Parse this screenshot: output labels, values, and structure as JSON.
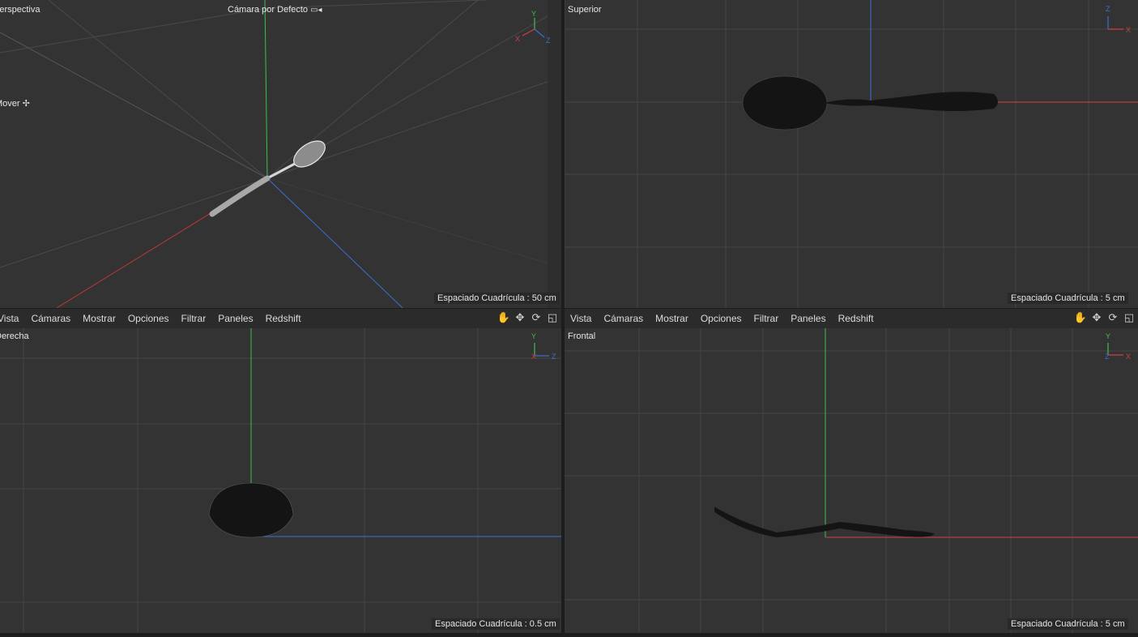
{
  "viewports": {
    "perspective": {
      "title": "Perspectiva",
      "camera": "Cámara por Defecto",
      "camera_icon": "camera-icon",
      "tool_label": "Mover",
      "tool_icon": "move-icon",
      "grid": "Espaciado Cuadrícula : 50 cm",
      "axes": {
        "x": "X",
        "y": "Y",
        "z": "Z"
      }
    },
    "top": {
      "title": "Superior",
      "grid": "Espaciado Cuadrícula : 5 cm",
      "axes": {
        "z": "Z",
        "x": "X"
      }
    },
    "right": {
      "title": "Derecha",
      "grid": "Espaciado Cuadrícula : 0.5 cm",
      "axes": {
        "y": "Y",
        "x": "X",
        "z": "Z"
      }
    },
    "front": {
      "title": "Frontal",
      "grid": "Espaciado Cuadrícula : 5 cm",
      "axes": {
        "y": "Y",
        "z": "Z",
        "x": "X"
      }
    }
  },
  "menu": [
    "Vista",
    "Cámaras",
    "Mostrar",
    "Opciones",
    "Filtrar",
    "Paneles",
    "Redshift"
  ],
  "menu_tools": [
    "hand-icon",
    "move-arrows-icon",
    "rotate-icon",
    "maximize-icon"
  ],
  "colors": {
    "x_axis": "#d04040",
    "y_axis": "#3fbf4f",
    "z_axis": "#3a6fd0",
    "viewport_bg": "#333333",
    "grid": "#474747"
  }
}
